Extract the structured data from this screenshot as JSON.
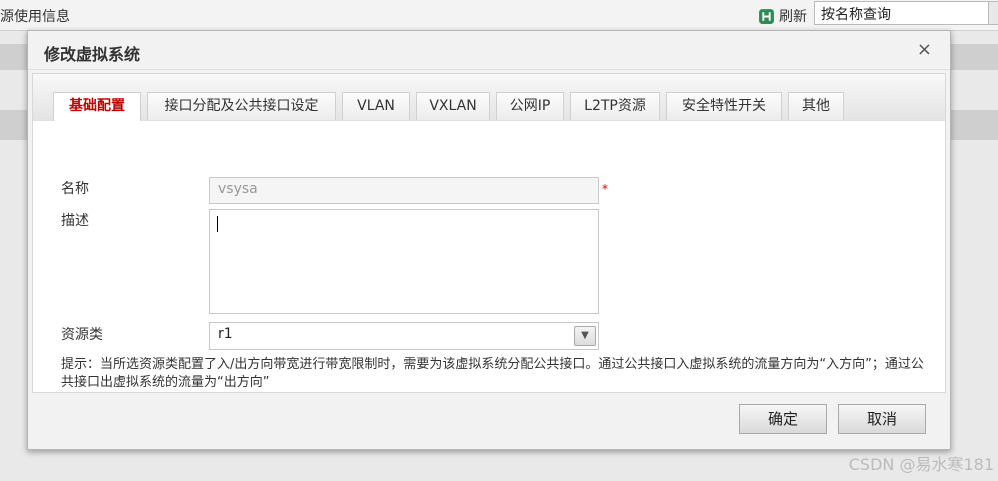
{
  "page": {
    "title_fragment": "源使用信息",
    "refresh_label": "刷新",
    "search_placeholder": "按名称查询",
    "watermark": "CSDN @易水寒181"
  },
  "dialog": {
    "title": "修改虚拟系统",
    "close": "×",
    "tabs": [
      {
        "label": "基础配置",
        "active": true
      },
      {
        "label": "接口分配及公共接口设定"
      },
      {
        "label": "VLAN"
      },
      {
        "label": "VXLAN"
      },
      {
        "label": "公网IP"
      },
      {
        "label": "L2TP资源"
      },
      {
        "label": "安全特性开关"
      },
      {
        "label": "其他"
      }
    ],
    "form": {
      "name_label": "名称",
      "name_value": "vsysa",
      "required_mark": "*",
      "desc_label": "描述",
      "desc_value": "",
      "resource_label": "资源类",
      "resource_value": "r1"
    },
    "hint": "提示：当所选资源类配置了入/出方向带宽进行带宽限制时，需要为该虚拟系统分配公共接口。通过公共接口入虚拟系统的流量方向为“入方向”；通过公共接口出虚拟系统的流量为“出方向”",
    "ok_label": "确定",
    "cancel_label": "取消"
  },
  "colors": {
    "active_tab": "#c00000",
    "required": "#dd0000",
    "refresh_icon": "#2e8b57"
  },
  "icons": {
    "refresh": "refresh-icon",
    "close": "close-icon",
    "dropdown": "chevron-down-icon"
  }
}
